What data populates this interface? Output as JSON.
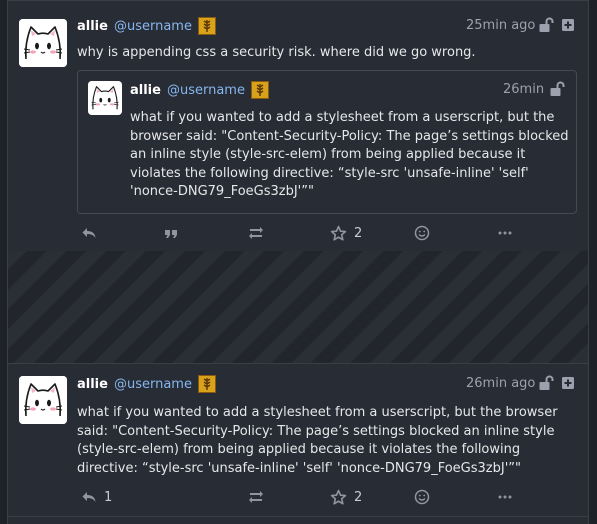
{
  "post1": {
    "display_name": "allie",
    "acct": "@username",
    "time": "25min ago",
    "content": "why is appending css a security risk. where did we go wrong.",
    "quote": {
      "display_name": "allie",
      "acct": "@username",
      "time": "26min",
      "content": "what if you wanted to add a stylesheet from a userscript, but the browser said: \"Content-Security-Policy: The page’s settings blocked an inline style (style-src-elem) from being applied because it violates the following directive: “style-src 'unsafe-inline' 'self' 'nonce-DNG79_FoeGs3zbJ'”\""
    },
    "actions": {
      "favourite_count": "2"
    }
  },
  "post2": {
    "display_name": "allie",
    "acct": "@username",
    "time": "26min ago",
    "content": "what if you wanted to add a stylesheet from a userscript, but the browser said: \"Content-Security-Policy: The page’s settings blocked an inline style (style-src-elem) from being applied because it violates the following directive: “style-src 'unsafe-inline' 'self' 'nonce-DNG79_FoeGs3zbJ'”\"",
    "actions": {
      "reply_count": "1",
      "favourite_count": "2"
    }
  },
  "icons": {
    "reply": "reply-icon",
    "quote": "quote-icon",
    "boost": "boost-icon",
    "favourite": "star-icon",
    "react": "emoji-icon",
    "more": "more-icon",
    "visibility": "unlock-icon",
    "expand": "plus-box-icon",
    "badge": "wheat-badge-icon"
  },
  "colors": {
    "background": "#282c34",
    "acct": "#86b6ef",
    "muted": "#9ba1ad",
    "badge": "#d9a21b"
  }
}
